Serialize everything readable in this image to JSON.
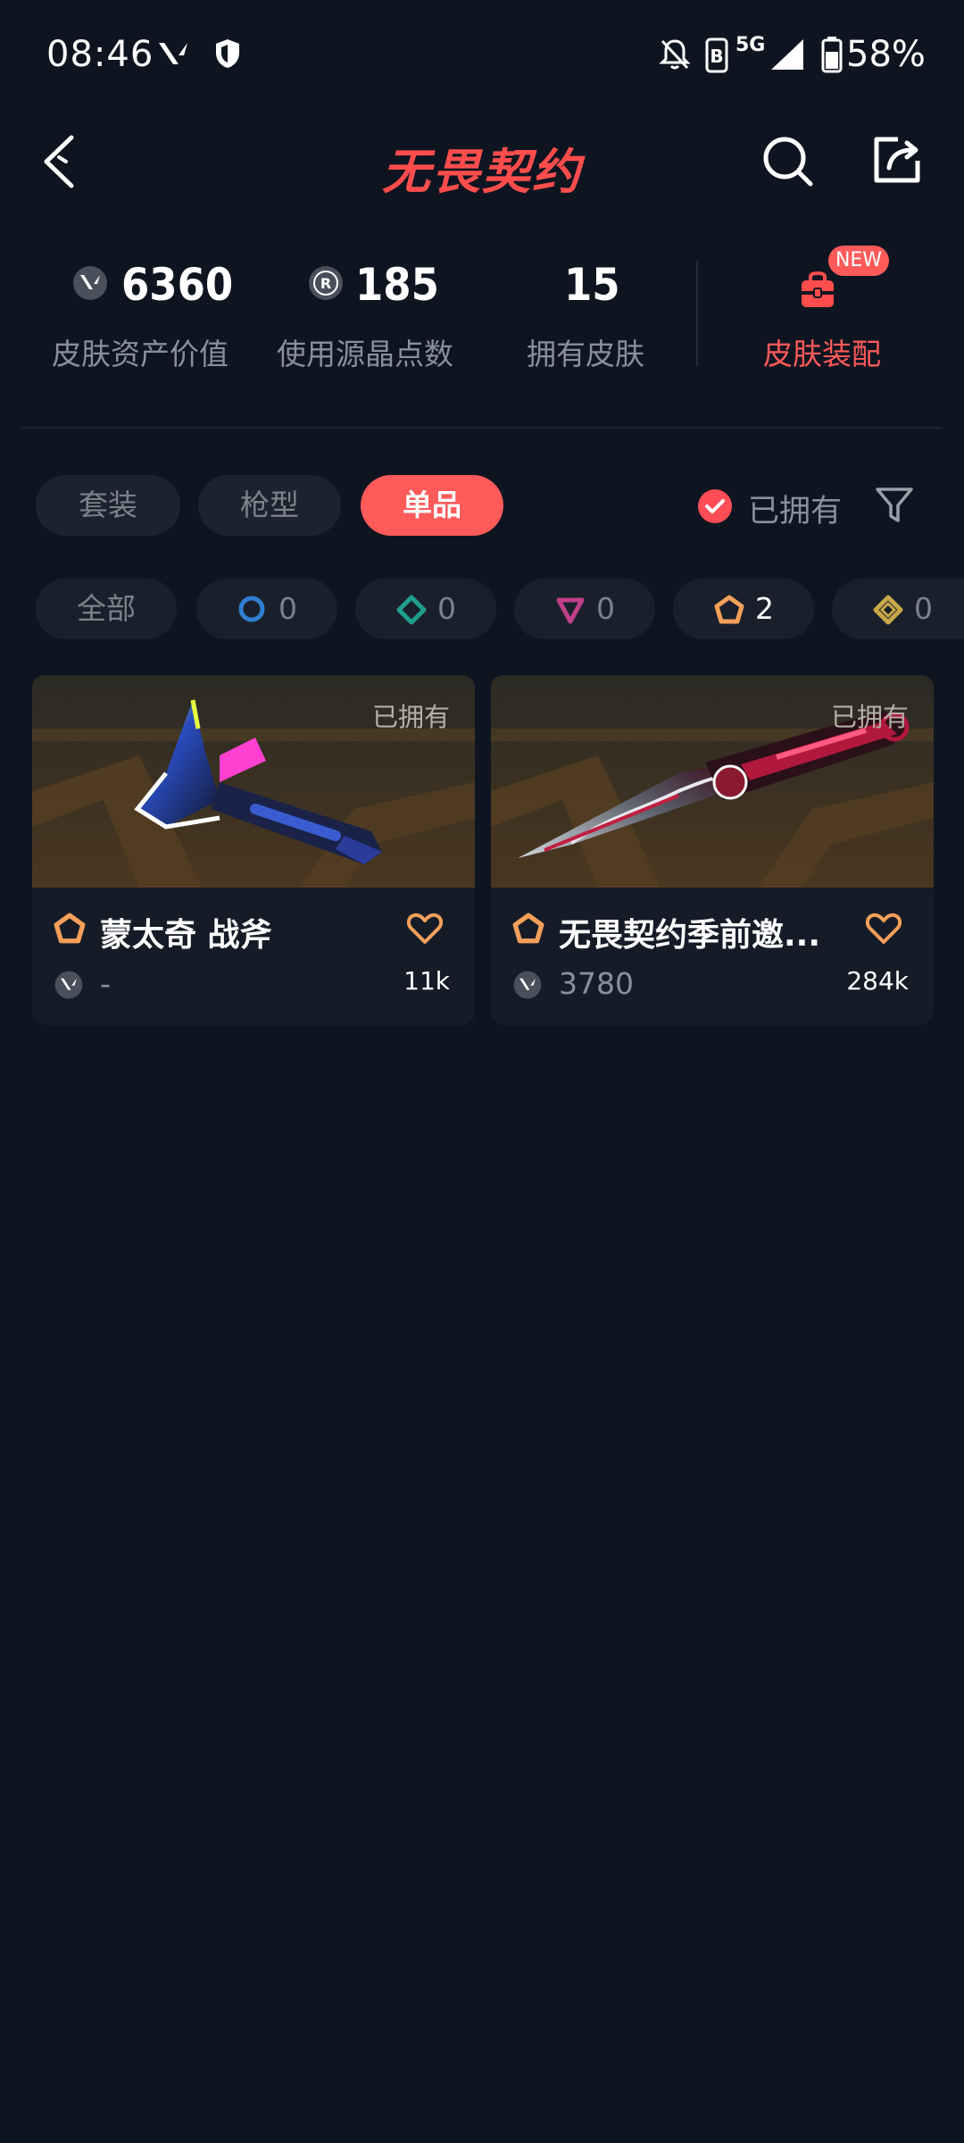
{
  "status_bar": {
    "time": "08:46",
    "network": "5G",
    "battery": "58%"
  },
  "header": {
    "title": "无畏契约",
    "back_icon": "chevron-left-icon",
    "search_icon": "search-icon",
    "share_icon": "share-icon"
  },
  "stats": {
    "asset_value": "6360",
    "asset_value_label": "皮肤资产价值",
    "radianite_points": "185",
    "radianite_points_label": "使用源晶点数",
    "owned_skins": "15",
    "owned_skins_label": "拥有皮肤",
    "outfit_label": "皮肤装配",
    "new_badge": "NEW"
  },
  "tabs": [
    {
      "label": "套装",
      "active": false
    },
    {
      "label": "枪型",
      "active": false
    },
    {
      "label": "单品",
      "active": true
    }
  ],
  "owned_filter": {
    "label": "已拥有",
    "checked": true
  },
  "rarity_filters": [
    {
      "label": "全部"
    },
    {
      "count": "0",
      "tier": "select",
      "color": "#2f7fd0"
    },
    {
      "count": "0",
      "tier": "deluxe",
      "color": "#1f9e8e"
    },
    {
      "count": "0",
      "tier": "premium",
      "color": "#c0408a"
    },
    {
      "count": "2",
      "tier": "exclusive",
      "color": "#f5a05a"
    },
    {
      "count": "0",
      "tier": "ultra",
      "color": "#c8a848"
    }
  ],
  "items": [
    {
      "owned_tag": "已拥有",
      "name": "蒙太奇 战斧",
      "price": "-",
      "likes": "11k"
    },
    {
      "owned_tag": "已拥有",
      "name": "无畏契约季前邀...",
      "price": "3780",
      "likes": "284k"
    }
  ],
  "colors": {
    "accent": "#ff5a5a",
    "background": "#0f1520"
  }
}
